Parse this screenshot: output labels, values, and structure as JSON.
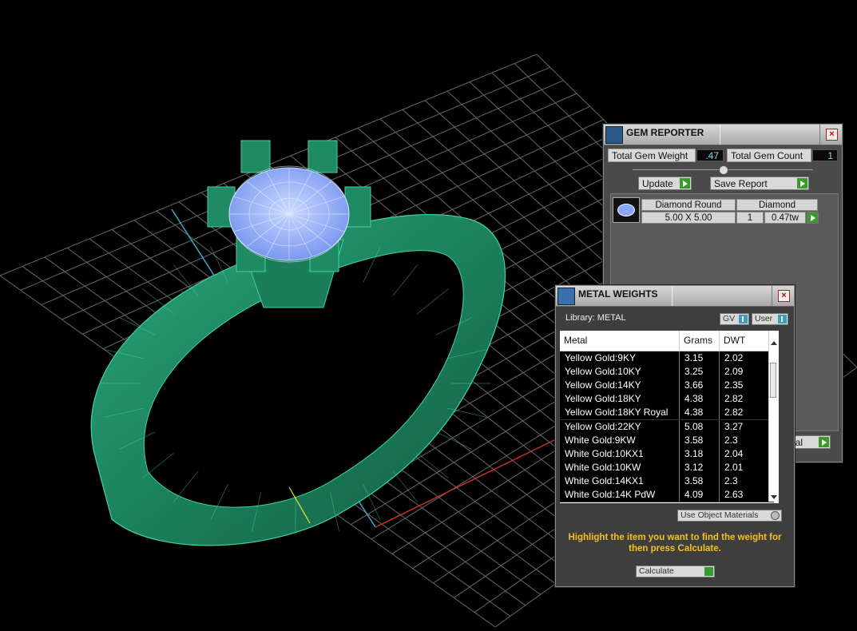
{
  "gem_reporter": {
    "title": "GEM REPORTER",
    "total_gem_weight_label": "Total Gem Weight",
    "total_gem_weight": ".47",
    "total_gem_count_label": "Total Gem Count",
    "total_gem_count": "1",
    "update_label": "Update",
    "save_report_label": "Save Report",
    "gem": {
      "shape": "Diamond Round",
      "type": "Diamond",
      "size": "5.00 X 5.00",
      "count": "1",
      "weight": "0.47tw"
    },
    "hidden_button_tail": "rial"
  },
  "metal_weights": {
    "title": "METAL WEIGHTS",
    "library_label": "Library: METAL",
    "gv_label": "GV",
    "user_label": "User",
    "columns": [
      "Metal",
      "Grams",
      "DWT"
    ],
    "rows": [
      {
        "metal": "Yellow Gold:9KY",
        "grams": "3.15",
        "dwt": "2.02"
      },
      {
        "metal": "Yellow Gold:10KY",
        "grams": "3.25",
        "dwt": "2.09"
      },
      {
        "metal": "Yellow Gold:14KY",
        "grams": "3.66",
        "dwt": "2.35"
      },
      {
        "metal": "Yellow Gold:18KY",
        "grams": "4.38",
        "dwt": "2.82"
      },
      {
        "metal": "Yellow Gold:18KY Royal",
        "grams": "4.38",
        "dwt": "2.82"
      },
      {
        "metal": "Yellow Gold:22KY",
        "grams": "5.08",
        "dwt": "3.27"
      },
      {
        "metal": "White Gold:9KW",
        "grams": "3.58",
        "dwt": "2.3"
      },
      {
        "metal": "White Gold:10KX1",
        "grams": "3.18",
        "dwt": "2.04"
      },
      {
        "metal": "White Gold:10KW",
        "grams": "3.12",
        "dwt": "2.01"
      },
      {
        "metal": "White Gold:14KX1",
        "grams": "3.58",
        "dwt": "2.3"
      },
      {
        "metal": "White Gold:14K PdW",
        "grams": "4.09",
        "dwt": "2.63"
      }
    ],
    "use_object_materials_label": "Use Object Materials",
    "hint_text": "Highlight the item you want to find the weight for then press Calculate.",
    "calculate_label": "Calculate"
  },
  "colors": {
    "ring_green": "#1e8a62",
    "ring_edge": "#3fd6a0",
    "gem_blue": "#8fb0ff",
    "grid": "#8a8a8a",
    "hint_yellow": "#f3c020",
    "go_green": "#3a9b2d"
  }
}
